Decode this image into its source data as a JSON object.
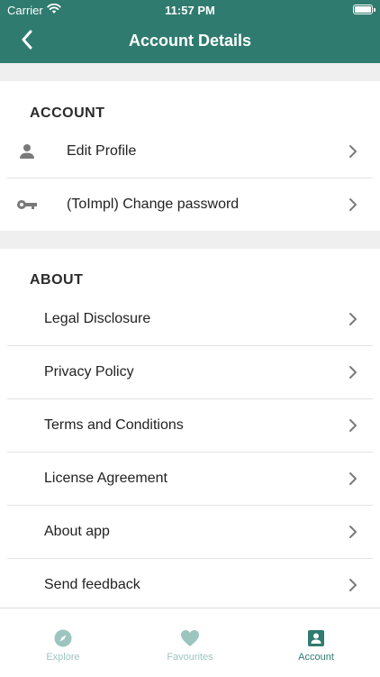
{
  "status_bar": {
    "carrier": "Carrier",
    "time": "11:57 PM"
  },
  "header": {
    "title": "Account Details"
  },
  "sections": {
    "account": {
      "title": "ACCOUNT",
      "items": [
        {
          "label": "Edit Profile",
          "icon": "person-icon"
        },
        {
          "label": "(ToImpl) Change password",
          "icon": "key-icon"
        }
      ]
    },
    "about": {
      "title": "ABOUT",
      "items": [
        {
          "label": "Legal Disclosure"
        },
        {
          "label": "Privacy Policy"
        },
        {
          "label": "Terms and Conditions"
        },
        {
          "label": "License Agreement"
        },
        {
          "label": "About app"
        },
        {
          "label": "Send feedback"
        }
      ]
    }
  },
  "tabbar": {
    "tabs": [
      {
        "label": "Explore",
        "icon": "compass-icon",
        "active": false
      },
      {
        "label": "Favourites",
        "icon": "heart-icon",
        "active": false
      },
      {
        "label": "Account",
        "icon": "account-box-icon",
        "active": true
      }
    ]
  },
  "colors": {
    "primary": "#2f7b6f",
    "inactive_tab": "#9cc5bf",
    "section_gap": "#efefef",
    "icon_gray": "#7a7a7a"
  }
}
